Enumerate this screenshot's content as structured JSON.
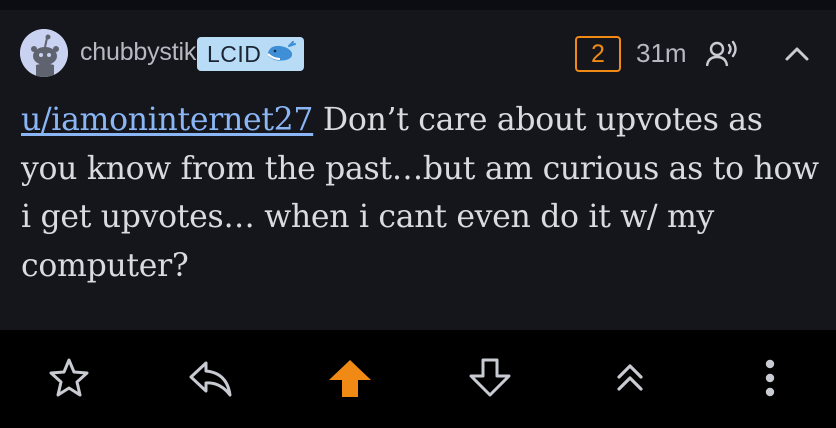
{
  "comment": {
    "author": "chubbystik",
    "flair": {
      "text": "LCID",
      "emoji": "whale-icon"
    },
    "score": "2",
    "age": "31m",
    "icons": {
      "voice": "speaker-icon",
      "collapse": "chevron-up-icon"
    },
    "body": {
      "mention": "u/iamoninternet27",
      "text": "Don’t care about upvotes as you know from the past…but am curious as to how i get upvotes… when i cant even do it w/ my computer?"
    }
  },
  "action_bar": {
    "items": [
      {
        "icon": "star-icon",
        "active": false
      },
      {
        "icon": "reply-icon",
        "active": false
      },
      {
        "icon": "upvote-arrow-icon",
        "active": true
      },
      {
        "icon": "downvote-arrow-icon",
        "active": false
      },
      {
        "icon": "double-chevron-up-icon",
        "active": false
      },
      {
        "icon": "more-vertical-icon",
        "active": false
      }
    ]
  },
  "colors": {
    "background": "#15161c",
    "action_bar": "#000000",
    "text": "#dadbe0",
    "meta_text": "#b6b9c2",
    "link": "#8ab6f6",
    "accent_orange": "#f08a14",
    "flair_bg": "#b8dcf6",
    "icon_gray": "#c9cbd2"
  }
}
